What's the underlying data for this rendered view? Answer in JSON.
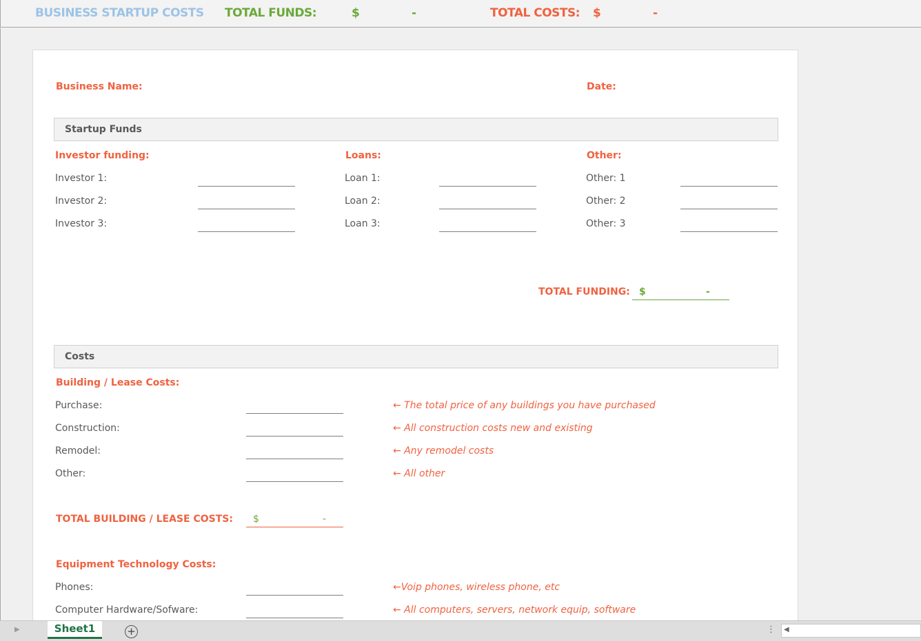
{
  "header": {
    "title": "BUSINESS STARTUP COSTS",
    "total_funds_label": "TOTAL FUNDS:",
    "total_funds_currency": "$",
    "total_funds_value": "-",
    "total_costs_label": "TOTAL COSTS:",
    "total_costs_currency": "$",
    "total_costs_value": "-"
  },
  "form": {
    "business_name_label": "Business Name:",
    "date_label": "Date:"
  },
  "funds": {
    "section": "Startup Funds",
    "investor": {
      "heading": "Investor funding:",
      "items": [
        "Investor 1:",
        "Investor 2:",
        "Investor 3:"
      ]
    },
    "loans": {
      "heading": "Loans:",
      "items": [
        "Loan 1:",
        "Loan 2:",
        "Loan 3:"
      ]
    },
    "other": {
      "heading": "Other:",
      "items": [
        "Other: 1",
        "Other: 2",
        "Other: 3"
      ]
    },
    "total_label": "TOTAL FUNDING:",
    "total_currency": "$",
    "total_value": "-"
  },
  "costs": {
    "section": "Costs",
    "building": {
      "heading": "Building / Lease Costs:",
      "items": [
        {
          "label": "Purchase:",
          "note": "← The total price of any buildings you have purchased"
        },
        {
          "label": "Construction:",
          "note": "← All construction costs new and existing"
        },
        {
          "label": "Remodel:",
          "note": "← Any remodel costs"
        },
        {
          "label": "Other:",
          "note": "← All other"
        }
      ],
      "total_label": "TOTAL BUILDING / LEASE COSTS:",
      "total_currency": "$",
      "total_value": "-"
    },
    "equipment": {
      "heading": "Equipment Technology Costs:",
      "items": [
        {
          "label": "Phones:",
          "note": "←Voip phones, wireless phone, etc"
        },
        {
          "label": "Computer Hardware/Sofware:",
          "note": "← All computers, servers, network equip, software"
        }
      ]
    }
  },
  "sheets": {
    "tabs": [
      "Sheet1"
    ],
    "add_icon": "plus-circle-icon"
  },
  "colors": {
    "accent": "#ef6240",
    "green": "#6aa93a",
    "blue": "#9dc3e6"
  }
}
